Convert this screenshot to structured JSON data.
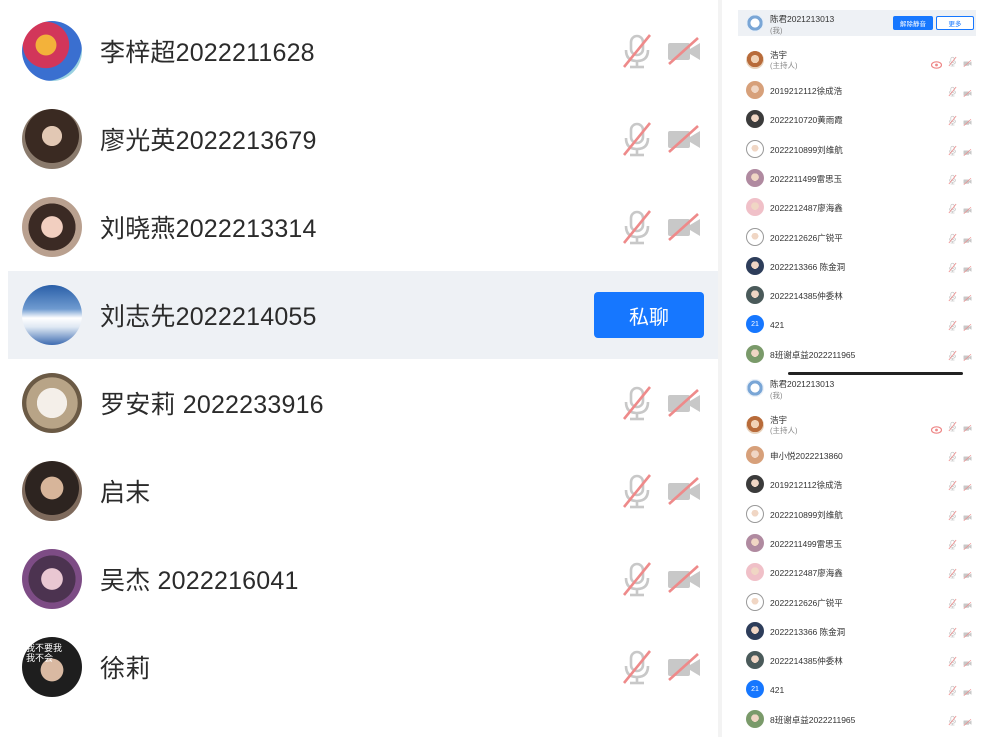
{
  "left_list": {
    "members": [
      {
        "name": "李梓超2022211628",
        "avatar": "avatar-colorful-icon"
      },
      {
        "name": "廖光英2022213679",
        "avatar": "avatar-photo-icon"
      },
      {
        "name": "刘晓燕2022213314",
        "avatar": "avatar-photo-icon"
      },
      {
        "name": "刘志先2022214055",
        "avatar": "avatar-sky-icon",
        "chat_label": "私聊"
      },
      {
        "name": "罗安莉 2022233916",
        "avatar": "avatar-dog-icon"
      },
      {
        "name": "启末",
        "avatar": "avatar-photo-icon"
      },
      {
        "name": "吴杰  2022216041",
        "avatar": "avatar-photo-icon"
      },
      {
        "name": "徐莉",
        "avatar": "avatar-photo-icon",
        "avatar_text": "我不要我\n我不会"
      }
    ]
  },
  "right_panel_top": {
    "header": {
      "name": "陈君2021213013",
      "sub": "(我)",
      "btn_primary": "解除静音",
      "btn_secondary": "更多"
    },
    "host": {
      "name": "浩宇",
      "sub": "(主持人)"
    },
    "members": [
      "2019212112徐成浩",
      "2022210720黄雨霞",
      "2022210899刘维航",
      "2022211499雷思玉",
      "2022212487廖海鑫",
      "2022212626广锐平",
      "2022213366 陈金洞",
      "2022214385仲委林",
      "421",
      "8班谢卓益2022211965"
    ]
  },
  "right_panel_bottom": {
    "header": {
      "name": "陈君2021213013",
      "sub": "(我)"
    },
    "host": {
      "name": "浩宇",
      "sub": "(主持人)"
    },
    "members": [
      "申小悦2022213860",
      "2019212112徐成浩",
      "2022210899刘维航",
      "2022211499雷思玉",
      "2022212487廖海鑫",
      "2022212626广锐平",
      "2022213366 陈金洞",
      "2022214385仲委林",
      "421",
      "8班谢卓益2022211965"
    ]
  },
  "colors": {
    "accent": "#1677ff",
    "muted_red": "#e8a0a0",
    "icon_gray": "#c9c9c9",
    "active_row": "#eef1f5"
  }
}
